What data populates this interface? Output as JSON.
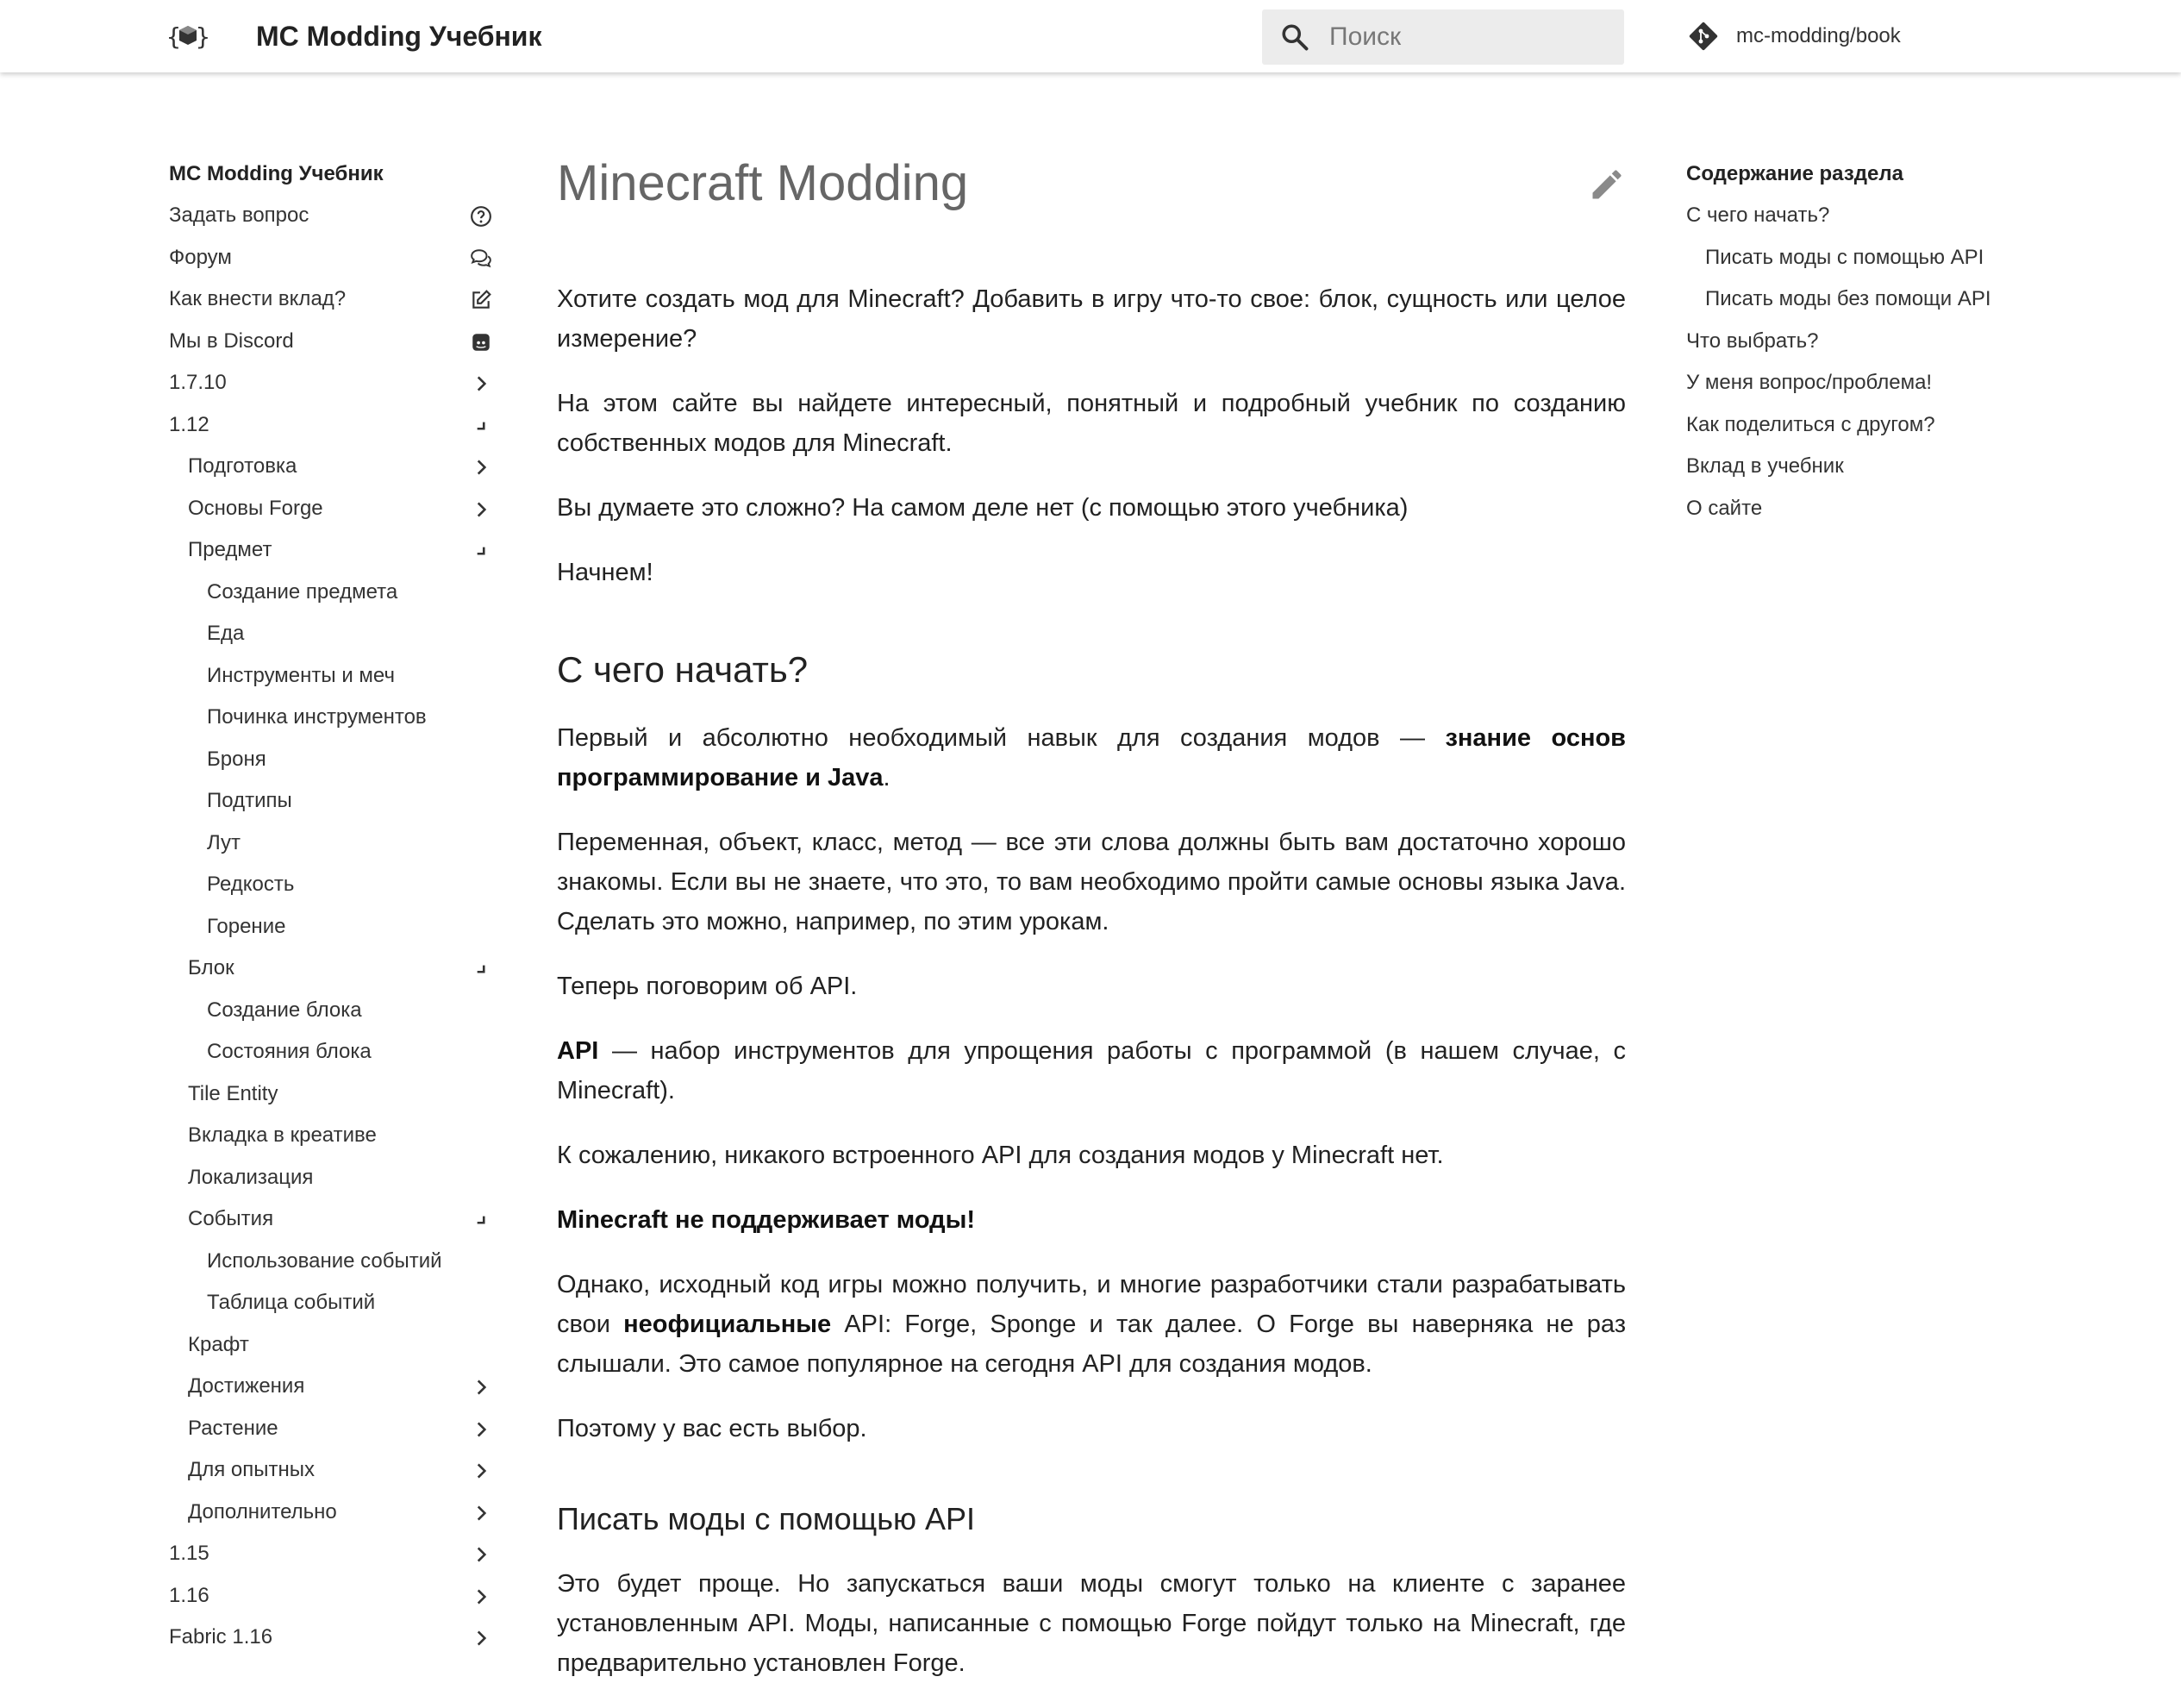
{
  "header": {
    "site_title": "MC Modding Учебник",
    "search_placeholder": "Поиск",
    "repo_name": "mc-modding/book"
  },
  "nav": {
    "title": "MC Modding Учебник",
    "items": [
      {
        "label": "Задать вопрос",
        "icon": "question-circle-icon"
      },
      {
        "label": "Форум",
        "icon": "chat-bubbles-icon"
      },
      {
        "label": "Как внести вклад?",
        "icon": "edit-square-icon"
      },
      {
        "label": "Мы в Discord",
        "icon": "discord-icon"
      },
      {
        "label": "1.7.10",
        "icon": "chevron-right-icon"
      },
      {
        "label": "1.12",
        "icon": "collapse-corner-icon"
      },
      {
        "label": "Подготовка",
        "icon": "chevron-right-icon"
      },
      {
        "label": "Основы Forge",
        "icon": "chevron-right-icon"
      },
      {
        "label": "Предмет",
        "icon": "collapse-corner-icon"
      },
      {
        "label": "Создание предмета"
      },
      {
        "label": "Еда"
      },
      {
        "label": "Инструменты и меч"
      },
      {
        "label": "Починка инструментов"
      },
      {
        "label": "Броня"
      },
      {
        "label": "Подтипы"
      },
      {
        "label": "Лут"
      },
      {
        "label": "Редкость"
      },
      {
        "label": "Горение"
      },
      {
        "label": "Блок",
        "icon": "collapse-corner-icon"
      },
      {
        "label": "Создание блока"
      },
      {
        "label": "Состояния блока"
      },
      {
        "label": "Tile Entity"
      },
      {
        "label": "Вкладка в креативе"
      },
      {
        "label": "Локализация"
      },
      {
        "label": "События",
        "icon": "collapse-corner-icon"
      },
      {
        "label": "Использование событий"
      },
      {
        "label": "Таблица событий"
      },
      {
        "label": "Крафт"
      },
      {
        "label": "Достижения",
        "icon": "chevron-right-icon"
      },
      {
        "label": "Растение",
        "icon": "chevron-right-icon"
      },
      {
        "label": "Для опытных",
        "icon": "chevron-right-icon"
      },
      {
        "label": "Дополнительно",
        "icon": "chevron-right-icon"
      },
      {
        "label": "1.15",
        "icon": "chevron-right-icon"
      },
      {
        "label": "1.16",
        "icon": "chevron-right-icon"
      },
      {
        "label": "Fabric 1.16",
        "icon": "chevron-right-icon"
      }
    ]
  },
  "main": {
    "title": "Minecraft Modding",
    "intro": [
      "Хотите создать мод для Minecraft? Добавить в игру что-то свое: блок, сущность или целое измерение?",
      "На этом сайте вы найдете интересный, понятный и подробный учебник по созданию собственных модов для Minecraft.",
      "Вы думаете это сложно? На самом деле нет (с помощью этого учебника)",
      "Начнем!"
    ],
    "section1": {
      "heading": "С чего начать?",
      "p1_pre": "Первый и абсолютно необходимый навык для создания модов — ",
      "p1_bold": "знание основ программирование и Java",
      "p1_post": ".",
      "p2": "Переменная, объект, класс, метод — все эти слова должны быть вам достаточно хорошо знакомы. Если вы не знаете, что это, то вам необходимо пройти самые основы языка Java. Сделать это можно, например, по этим урокам.",
      "p3": "Теперь поговорим об API.",
      "p4_bold": "API",
      "p4_rest": " — набор инструментов для упрощения работы с программой (в нашем случае, с Minecraft).",
      "p5": "К сожалению, никакого встроенного API для создания модов у Minecraft нет.",
      "p6_bold": "Minecraft не поддерживает моды!",
      "p7_pre": "Однако, исходный код игры можно получить, и многие разработчики стали разрабатывать свои ",
      "p7_bold": "неофициальные",
      "p7_post": " API: Forge, Sponge и так далее. О Forge вы наверняка не раз слышали. Это самое популярное на сегодня API для создания модов.",
      "p8": "Поэтому у вас есть выбор."
    },
    "section2": {
      "heading": "Писать моды с помощью API",
      "p1": "Это будет проще. Но запускаться ваши моды смогут только на клиенте с заранее установленным API. Моды, написанные с помощью Forge пойдут только на Minecraft, где предварительно установлен Forge."
    }
  },
  "toc": {
    "title": "Содержание раздела",
    "items": [
      {
        "label": "С чего начать?"
      },
      {
        "label": "Писать моды с помощью API",
        "sub": true
      },
      {
        "label": "Писать моды без помощи API",
        "sub": true
      },
      {
        "label": "Что выбрать?"
      },
      {
        "label": "У меня вопрос/проблема!"
      },
      {
        "label": "Как поделиться с другом?"
      },
      {
        "label": "Вклад в учебник"
      },
      {
        "label": "О сайте"
      }
    ]
  },
  "colors": {
    "header_bg": "#ffffff",
    "search_bg": "#ececec",
    "title_grey": "#666666",
    "text": "#222222"
  }
}
